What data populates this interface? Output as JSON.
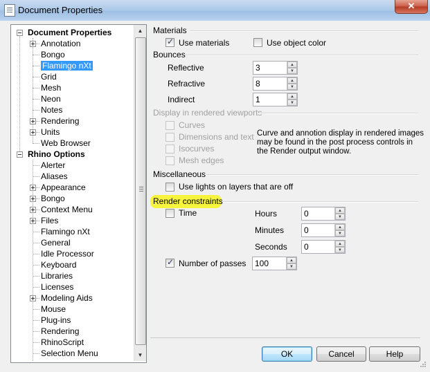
{
  "window": {
    "title": "Document Properties",
    "close_label": "✕"
  },
  "tree": {
    "items": [
      {
        "label": "Document Properties",
        "level": 0,
        "bold": true,
        "expander": "minus"
      },
      {
        "label": "Annotation",
        "level": 1,
        "expander": "plus"
      },
      {
        "label": "Bongo",
        "level": 1
      },
      {
        "label": "Flamingo nXt",
        "level": 1,
        "selected": true
      },
      {
        "label": "Grid",
        "level": 1
      },
      {
        "label": "Mesh",
        "level": 1
      },
      {
        "label": "Neon",
        "level": 1
      },
      {
        "label": "Notes",
        "level": 1
      },
      {
        "label": "Rendering",
        "level": 1,
        "expander": "plus"
      },
      {
        "label": "Units",
        "level": 1,
        "expander": "plus"
      },
      {
        "label": "Web Browser",
        "level": 1
      },
      {
        "label": "Rhino Options",
        "level": 0,
        "bold": true,
        "expander": "minus"
      },
      {
        "label": "Alerter",
        "level": 1
      },
      {
        "label": "Aliases",
        "level": 1
      },
      {
        "label": "Appearance",
        "level": 1,
        "expander": "plus"
      },
      {
        "label": "Bongo",
        "level": 1,
        "expander": "plus"
      },
      {
        "label": "Context Menu",
        "level": 1,
        "expander": "plus"
      },
      {
        "label": "Files",
        "level": 1,
        "expander": "plus"
      },
      {
        "label": "Flamingo nXt",
        "level": 1
      },
      {
        "label": "General",
        "level": 1
      },
      {
        "label": "Idle Processor",
        "level": 1
      },
      {
        "label": "Keyboard",
        "level": 1
      },
      {
        "label": "Libraries",
        "level": 1
      },
      {
        "label": "Licenses",
        "level": 1
      },
      {
        "label": "Modeling Aids",
        "level": 1,
        "expander": "plus"
      },
      {
        "label": "Mouse",
        "level": 1
      },
      {
        "label": "Plug-ins",
        "level": 1
      },
      {
        "label": "Rendering",
        "level": 1
      },
      {
        "label": "RhinoScript",
        "level": 1
      },
      {
        "label": "Selection Menu",
        "level": 1
      }
    ]
  },
  "materials": {
    "heading": "Materials",
    "use_materials": {
      "label": "Use materials",
      "checked": true
    },
    "use_object_color": {
      "label": "Use object color",
      "checked": false
    }
  },
  "bounces": {
    "heading": "Bounces",
    "reflective": {
      "label": "Reflective",
      "value": "3"
    },
    "refractive": {
      "label": "Refractive",
      "value": "8"
    },
    "indirect": {
      "label": "Indirect",
      "value": "1"
    }
  },
  "display": {
    "heading": "Display in rendered viewports",
    "curves": "Curves",
    "dimensions": "Dimensions and text",
    "isocurves": "Isocurves",
    "mesh_edges": "Mesh edges",
    "note_lines": [
      "Curve and annotion display in rendered images",
      "may be found in the post process controls in",
      "the Render output window."
    ]
  },
  "misc": {
    "heading": "Miscellaneous",
    "use_lights": {
      "label": "Use lights on layers that are off",
      "checked": false
    }
  },
  "constraints": {
    "heading": "Render constraints",
    "time": {
      "label": "Time",
      "checked": false
    },
    "hours": {
      "label": "Hours",
      "value": "0"
    },
    "minutes": {
      "label": "Minutes",
      "value": "0"
    },
    "seconds": {
      "label": "Seconds",
      "value": "0"
    },
    "passes": {
      "label": "Number of passes",
      "checked": true,
      "value": "100"
    }
  },
  "buttons": {
    "ok": "OK",
    "cancel": "Cancel",
    "help": "Help"
  },
  "spin_up": "▲",
  "spin_down": "▼",
  "scroll_up": "▲",
  "scroll_down": "▼"
}
